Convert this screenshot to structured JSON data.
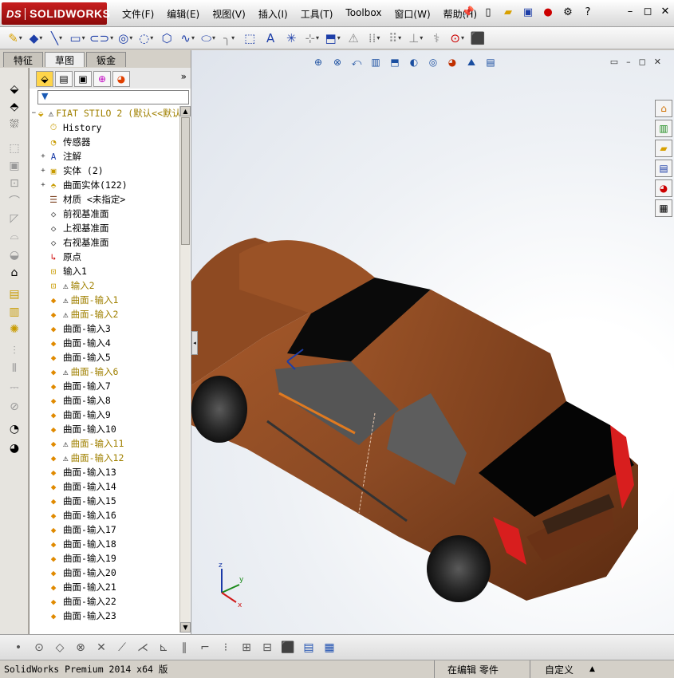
{
  "app": {
    "logo_prefix": "DS",
    "logo_text": "SOLIDWORKS"
  },
  "menu": [
    "文件(F)",
    "编辑(E)",
    "视图(V)",
    "插入(I)",
    "工具(T)",
    "Toolbox",
    "窗口(W)",
    "帮助(H)"
  ],
  "tabs": [
    "特征",
    "草图",
    "钣金"
  ],
  "active_tab": "草图",
  "tree": {
    "root_label": "FIAT STILO 2  (默认<<默认",
    "items": [
      {
        "label": "History",
        "icon": "history-icon",
        "expandable": false,
        "warn": false
      },
      {
        "label": "传感器",
        "icon": "sensor-icon",
        "expandable": false,
        "warn": false
      },
      {
        "label": "注解",
        "icon": "annotation-icon",
        "expandable": true,
        "warn": false
      },
      {
        "label": "实体 (2)",
        "icon": "solid-body-icon",
        "expandable": true,
        "warn": false
      },
      {
        "label": "曲面实体(122)",
        "icon": "surface-body-icon",
        "expandable": true,
        "warn": false
      },
      {
        "label": "材质 <未指定>",
        "icon": "material-icon",
        "expandable": false,
        "warn": false
      },
      {
        "label": "前视基准面",
        "icon": "plane-icon",
        "expandable": false,
        "warn": false
      },
      {
        "label": "上视基准面",
        "icon": "plane-icon",
        "expandable": false,
        "warn": false
      },
      {
        "label": "右视基准面",
        "icon": "plane-icon",
        "expandable": false,
        "warn": false
      },
      {
        "label": "原点",
        "icon": "origin-icon",
        "expandable": false,
        "warn": false
      },
      {
        "label": "输入1",
        "icon": "import-icon",
        "expandable": false,
        "warn": false
      },
      {
        "label": "输入2",
        "icon": "import-icon",
        "expandable": false,
        "warn": true
      },
      {
        "label": "曲面-输入1",
        "icon": "surface-import-icon",
        "expandable": false,
        "warn": true
      },
      {
        "label": "曲面-输入2",
        "icon": "surface-import-icon",
        "expandable": false,
        "warn": true
      },
      {
        "label": "曲面-输入3",
        "icon": "surface-import-icon",
        "expandable": false,
        "warn": false
      },
      {
        "label": "曲面-输入4",
        "icon": "surface-import-icon",
        "expandable": false,
        "warn": false
      },
      {
        "label": "曲面-输入5",
        "icon": "surface-import-icon",
        "expandable": false,
        "warn": false
      },
      {
        "label": "曲面-输入6",
        "icon": "surface-import-icon",
        "expandable": false,
        "warn": true
      },
      {
        "label": "曲面-输入7",
        "icon": "surface-import-icon",
        "expandable": false,
        "warn": false
      },
      {
        "label": "曲面-输入8",
        "icon": "surface-import-icon",
        "expandable": false,
        "warn": false
      },
      {
        "label": "曲面-输入9",
        "icon": "surface-import-icon",
        "expandable": false,
        "warn": false
      },
      {
        "label": "曲面-输入10",
        "icon": "surface-import-icon",
        "expandable": false,
        "warn": false
      },
      {
        "label": "曲面-输入11",
        "icon": "surface-import-icon",
        "expandable": false,
        "warn": true
      },
      {
        "label": "曲面-输入12",
        "icon": "surface-import-icon",
        "expandable": false,
        "warn": true
      },
      {
        "label": "曲面-输入13",
        "icon": "surface-import-icon",
        "expandable": false,
        "warn": false
      },
      {
        "label": "曲面-输入14",
        "icon": "surface-import-icon",
        "expandable": false,
        "warn": false
      },
      {
        "label": "曲面-输入15",
        "icon": "surface-import-icon",
        "expandable": false,
        "warn": false
      },
      {
        "label": "曲面-输入16",
        "icon": "surface-import-icon",
        "expandable": false,
        "warn": false
      },
      {
        "label": "曲面-输入17",
        "icon": "surface-import-icon",
        "expandable": false,
        "warn": false
      },
      {
        "label": "曲面-输入18",
        "icon": "surface-import-icon",
        "expandable": false,
        "warn": false
      },
      {
        "label": "曲面-输入19",
        "icon": "surface-import-icon",
        "expandable": false,
        "warn": false
      },
      {
        "label": "曲面-输入20",
        "icon": "surface-import-icon",
        "expandable": false,
        "warn": false
      },
      {
        "label": "曲面-输入21",
        "icon": "surface-import-icon",
        "expandable": false,
        "warn": false
      },
      {
        "label": "曲面-输入22",
        "icon": "surface-import-icon",
        "expandable": false,
        "warn": false
      },
      {
        "label": "曲面-输入23",
        "icon": "surface-import-icon",
        "expandable": false,
        "warn": false
      }
    ]
  },
  "status": {
    "product": "SolidWorks Premium 2014 x64 版",
    "mode": "在编辑 零件",
    "units": "自定义"
  },
  "colors": {
    "car_body": "#8b4a24",
    "glass": "#0a0a0a",
    "taillight": "#d81e1e",
    "warn_text": "#a08000",
    "accent_blue": "#1d3ea8"
  }
}
